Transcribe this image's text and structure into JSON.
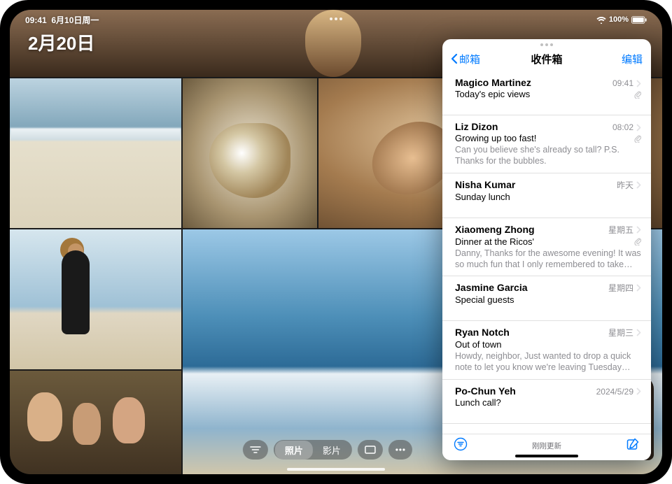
{
  "status": {
    "time": "09:41",
    "date": "6月10日周一",
    "battery_pct": "100%"
  },
  "photos": {
    "date_title": "2月20日",
    "segment_photos": "照片",
    "segment_videos": "影片"
  },
  "mail": {
    "back_label": "邮箱",
    "title": "收件箱",
    "edit_label": "编辑",
    "footer_status": "刚刚更新",
    "messages": [
      {
        "sender": "Magico Martinez",
        "time": "09:41",
        "subject": "Today's epic views",
        "preview": "",
        "has_attachment": true
      },
      {
        "sender": "Liz Dizon",
        "time": "08:02",
        "subject": "Growing up too fast!",
        "preview": "Can you believe she's already so tall? P.S. Thanks for the bubbles.",
        "has_attachment": true
      },
      {
        "sender": "Nisha Kumar",
        "time": "昨天",
        "subject": "Sunday lunch",
        "preview": "",
        "has_attachment": false
      },
      {
        "sender": "Xiaomeng Zhong",
        "time": "星期五",
        "subject": "Dinner at the Ricos'",
        "preview": "Danny, Thanks for the awesome evening! It was so much fun that I only remembered to take on…",
        "has_attachment": true
      },
      {
        "sender": "Jasmine Garcia",
        "time": "星期四",
        "subject": "Special guests",
        "preview": "",
        "has_attachment": false
      },
      {
        "sender": "Ryan Notch",
        "time": "星期三",
        "subject": "Out of town",
        "preview": "Howdy, neighbor, Just wanted to drop a quick note to let you know we're leaving Tuesday an…",
        "has_attachment": false
      },
      {
        "sender": "Po-Chun Yeh",
        "time": "2024/5/29",
        "subject": "Lunch call?",
        "preview": "",
        "has_attachment": false
      }
    ]
  }
}
